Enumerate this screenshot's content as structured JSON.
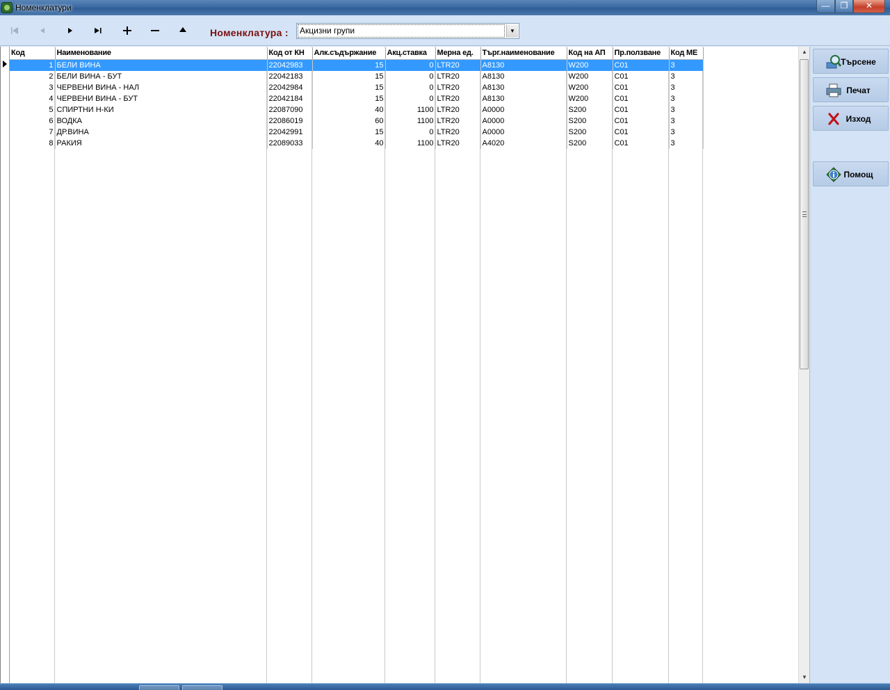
{
  "window": {
    "title": "Номенклатури",
    "min_label": "—",
    "max_label": "❐",
    "close_label": "✕"
  },
  "toolbar": {
    "first": "⏮",
    "prev": "◀",
    "next": "▶",
    "last": "▶|",
    "add": "+",
    "remove": "−",
    "up": "▲",
    "nomenclature_label": "Номенклатура :",
    "nomenclature_value": "Акцизни групи"
  },
  "grid": {
    "columns": [
      "Код",
      "Наименование",
      "Код от КН",
      "Алк.съдържание",
      "Акц.ставка",
      "Мерна ед.",
      "Търг.наименование",
      "Код на АП",
      "Пр.ползване",
      "Код МЕ"
    ],
    "rows": [
      [
        "1",
        "БЕЛИ ВИНА",
        "22042983",
        "15",
        "0",
        "LTR20",
        "A8130",
        "W200",
        "C01",
        "3"
      ],
      [
        "2",
        "БЕЛИ ВИНА - БУТ",
        "22042183",
        "15",
        "0",
        "LTR20",
        "A8130",
        "W200",
        "C01",
        "3"
      ],
      [
        "3",
        "ЧЕРВЕНИ ВИНА - НАЛ",
        "22042984",
        "15",
        "0",
        "LTR20",
        "A8130",
        "W200",
        "C01",
        "3"
      ],
      [
        "4",
        "ЧЕРВЕНИ ВИНА - БУТ",
        "22042184",
        "15",
        "0",
        "LTR20",
        "A8130",
        "W200",
        "C01",
        "3"
      ],
      [
        "5",
        "СПИРТНИ Н-КИ",
        "22087090",
        "40",
        "1100",
        "LTR20",
        "A0000",
        "S200",
        "C01",
        "3"
      ],
      [
        "6",
        "ВОДКА",
        "22086019",
        "60",
        "1100",
        "LTR20",
        "A0000",
        "S200",
        "C01",
        "3"
      ],
      [
        "7",
        "ДР.ВИНА",
        "22042991",
        "15",
        "0",
        "LTR20",
        "A0000",
        "S200",
        "C01",
        "3"
      ],
      [
        "8",
        "РАКИЯ",
        "22089033",
        "40",
        "1100",
        "LTR20",
        "A4020",
        "S200",
        "C01",
        "3"
      ]
    ],
    "selected_row": 0
  },
  "side": {
    "search": "Търсене",
    "print": "Печат",
    "exit": "Изход",
    "help": "Помощ"
  },
  "colors": {
    "selection": "#3399ff",
    "label_red": "#7a0f0f",
    "panel_bg": "#d4e3f5"
  }
}
